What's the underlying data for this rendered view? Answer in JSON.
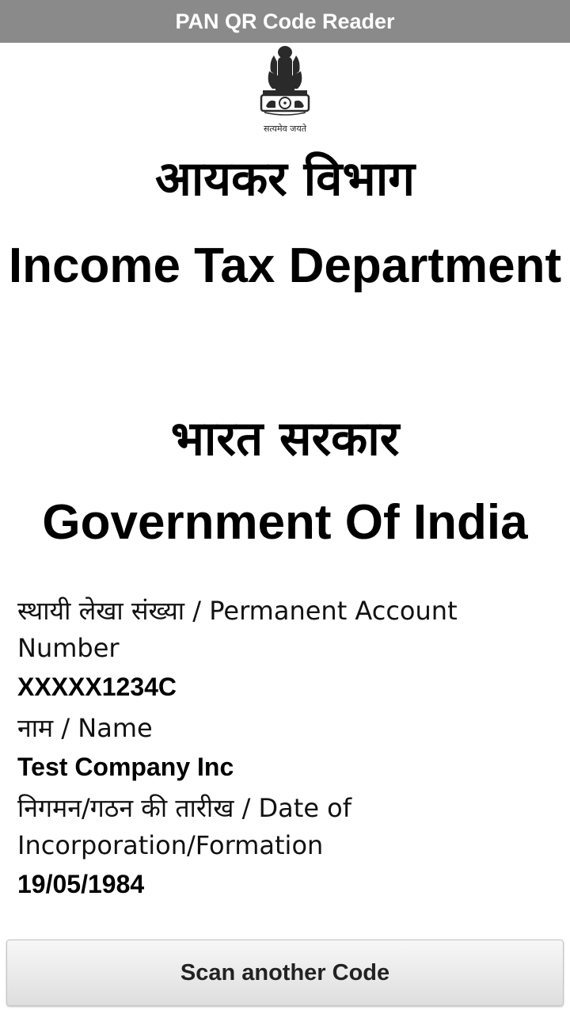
{
  "app": {
    "title": "PAN QR Code Reader"
  },
  "card": {
    "emblem_motto": "सत्यमेव जयते",
    "dept_hindi": "आयकर विभाग",
    "dept_english": "Income Tax Department",
    "govt_hindi": "भारत सरकार",
    "govt_english": "Government Of India"
  },
  "fields": {
    "pan_label": "स्थायी लेखा संख्या / Permanent Account Number",
    "pan_value": "XXXXX1234C",
    "name_label": "नाम / Name",
    "name_value": "Test Company Inc",
    "doi_label": "निगमन/गठन की तारीख / Date of Incorporation/Formation",
    "doi_value": "19/05/1984"
  },
  "actions": {
    "scan_label": "Scan another Code"
  },
  "colors": {
    "titlebar_bg": "#8a8a8a",
    "titlebar_text": "#ffffff",
    "body_bg": "#ffffff"
  }
}
